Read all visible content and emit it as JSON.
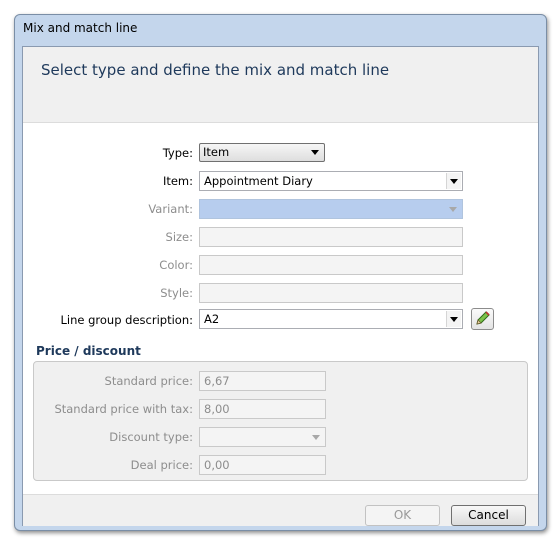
{
  "window": {
    "title": "Mix and match line",
    "help_glyph": "?"
  },
  "header": {
    "title": "Select type and define the mix and match line"
  },
  "form": {
    "type": {
      "label": "Type:",
      "value": "Item"
    },
    "item": {
      "label": "Item:",
      "value": "Appointment Diary"
    },
    "variant": {
      "label": "Variant:",
      "value": ""
    },
    "size": {
      "label": "Size:",
      "value": ""
    },
    "color": {
      "label": "Color:",
      "value": ""
    },
    "style": {
      "label": "Style:",
      "value": ""
    },
    "line_group": {
      "label": "Line group description:",
      "value": "A2"
    }
  },
  "price_section": {
    "title": "Price / discount",
    "standard_price": {
      "label": "Standard price:",
      "value": "6,67"
    },
    "standard_price_tax": {
      "label": "Standard price with tax:",
      "value": "8,00"
    },
    "discount_type": {
      "label": "Discount type:",
      "value": ""
    },
    "deal_price": {
      "label": "Deal price:",
      "value": "0,00"
    }
  },
  "buttons": {
    "ok": "OK",
    "cancel": "Cancel"
  }
}
